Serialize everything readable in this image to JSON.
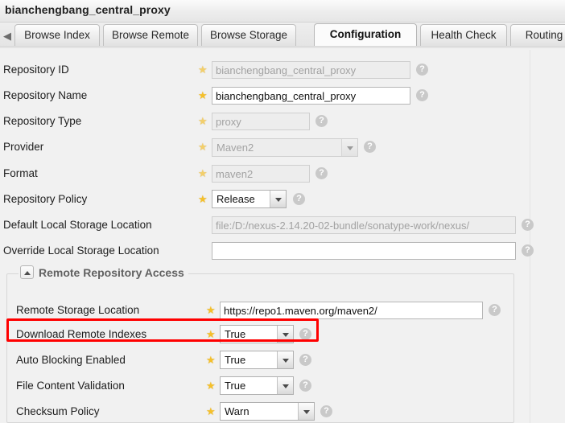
{
  "window": {
    "title": "bianchengbang_central_proxy"
  },
  "tabs": {
    "scroll_left_icon": "left-arrow-icon",
    "items": [
      {
        "label": "Browse Index",
        "active": false
      },
      {
        "label": "Browse Remote",
        "active": false
      },
      {
        "label": "Browse Storage",
        "active": false
      },
      {
        "label": "Configuration",
        "active": true
      },
      {
        "label": "Health Check",
        "active": false
      },
      {
        "label": "Routing",
        "active": false
      }
    ]
  },
  "help_icon": "?",
  "required_marker": "★",
  "form": {
    "rows": [
      {
        "label": "Repository ID",
        "value": "bianchengbang_central_proxy",
        "control": "text",
        "disabled": true,
        "required": true
      },
      {
        "label": "Repository Name",
        "value": "bianchengbang_central_proxy",
        "control": "text",
        "disabled": false,
        "required": true
      },
      {
        "label": "Repository Type",
        "value": "proxy",
        "control": "text",
        "disabled": true,
        "required": true
      },
      {
        "label": "Provider",
        "value": "Maven2",
        "control": "combo",
        "disabled": true,
        "required": true
      },
      {
        "label": "Format",
        "value": "maven2",
        "control": "text",
        "disabled": true,
        "required": true
      },
      {
        "label": "Repository Policy",
        "value": "Release",
        "control": "combo",
        "disabled": false,
        "required": true
      },
      {
        "label": "Default Local Storage Location",
        "value": "file:/D:/nexus-2.14.20-02-bundle/sonatype-work/nexus/",
        "control": "text",
        "disabled": true,
        "required": false
      },
      {
        "label": "Override Local Storage Location",
        "value": "",
        "control": "text",
        "disabled": false,
        "required": false
      }
    ]
  },
  "remote_section": {
    "legend": "Remote Repository Access",
    "collapse_icon": "chevron-up-icon",
    "rows": [
      {
        "label": "Remote Storage Location",
        "value": "https://repo1.maven.org/maven2/",
        "control": "text",
        "disabled": false,
        "required": true
      },
      {
        "label": "Download Remote Indexes",
        "value": "True",
        "control": "combo",
        "disabled": false,
        "required": true,
        "highlighted": true
      },
      {
        "label": "Auto Blocking Enabled",
        "value": "True",
        "control": "combo",
        "disabled": false,
        "required": true
      },
      {
        "label": "File Content Validation",
        "value": "True",
        "control": "combo",
        "disabled": false,
        "required": true
      },
      {
        "label": "Checksum Policy",
        "value": "Warn",
        "control": "combo",
        "disabled": false,
        "required": true
      }
    ]
  },
  "annotation": {
    "type": "highlight-rectangle",
    "color": "#ff0000",
    "target": "Download Remote Indexes"
  }
}
